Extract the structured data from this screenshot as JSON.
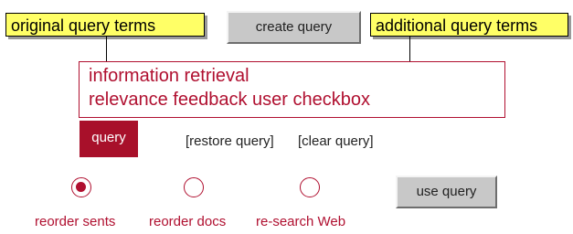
{
  "callouts": {
    "original": "original query terms",
    "additional": "additional query terms"
  },
  "toolbar": {
    "create_query": "create query",
    "use_query": "use query"
  },
  "query_box": {
    "line1": "information retrieval",
    "line2": "relevance feedback user checkbox"
  },
  "actions": {
    "query": "query",
    "restore": "[restore query]",
    "clear": "[clear query]"
  },
  "options": [
    {
      "label": "reorder sents",
      "selected": true
    },
    {
      "label": "reorder docs",
      "selected": false
    },
    {
      "label": "re-search Web",
      "selected": false
    }
  ],
  "colors": {
    "accent": "#b01030",
    "callout_bg": "#ffff66",
    "button_grey": "#c8c8c8"
  }
}
